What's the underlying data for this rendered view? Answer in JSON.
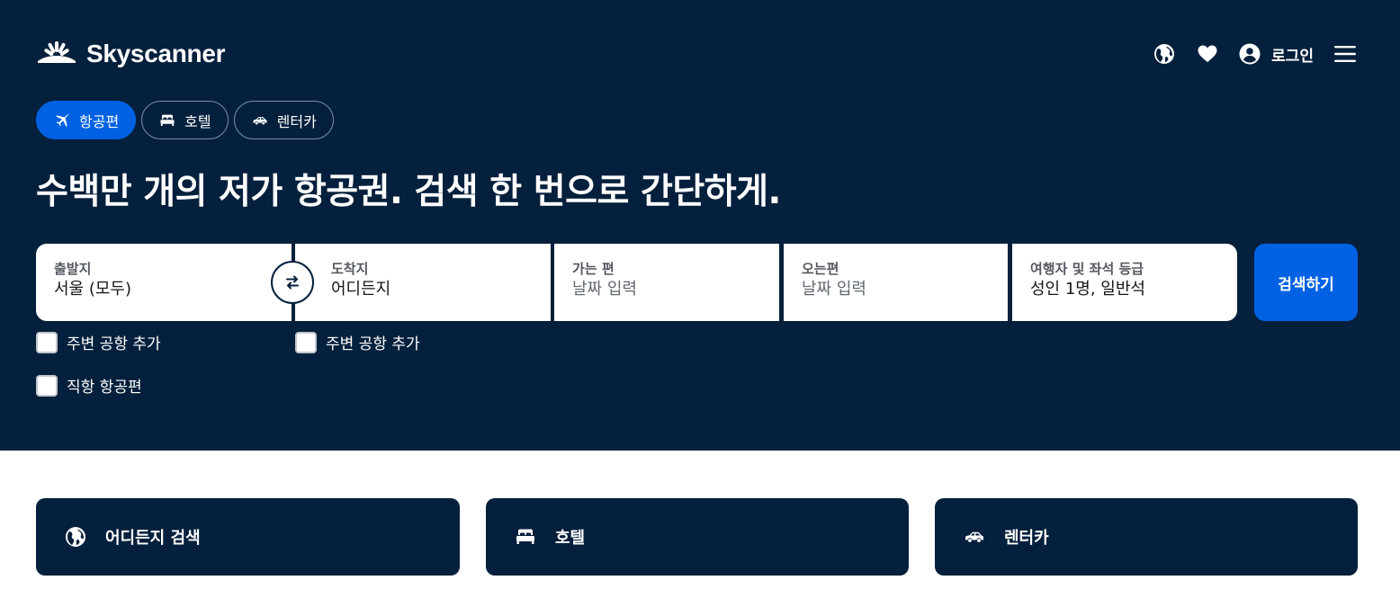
{
  "brand": {
    "name": "Skyscanner"
  },
  "header": {
    "login_label": "로그인"
  },
  "nav_pills": [
    {
      "label": "항공편",
      "active": true,
      "icon": "plane-icon"
    },
    {
      "label": "호텔",
      "active": false,
      "icon": "bed-icon"
    },
    {
      "label": "렌터카",
      "active": false,
      "icon": "car-icon"
    }
  ],
  "headline": "수백만 개의 저가 항공권. 검색 한 번으로 간단하게.",
  "search": {
    "origin": {
      "label": "출발지",
      "value": "서울 (모두)"
    },
    "destination": {
      "label": "도착지",
      "value": "어디든지"
    },
    "depart": {
      "label": "가는 편",
      "placeholder": "날짜 입력"
    },
    "return": {
      "label": "오는편",
      "placeholder": "날짜 입력"
    },
    "travellers": {
      "label": "여행자 및 좌석 등급",
      "value": "성인 1명, 일반석"
    },
    "button_label": "검색하기"
  },
  "checkboxes": {
    "origin_nearby": "주변 공항 추가",
    "dest_nearby": "주변 공항 추가",
    "direct": "직항 항공편"
  },
  "cards": [
    {
      "label": "어디든지 검색",
      "icon": "globe-icon"
    },
    {
      "label": "호텔",
      "icon": "bed-icon"
    },
    {
      "label": "렌터카",
      "icon": "car-icon"
    }
  ],
  "colors": {
    "hero_bg": "#05203c",
    "accent": "#0062e3",
    "text_on_dark": "#ffffff"
  }
}
